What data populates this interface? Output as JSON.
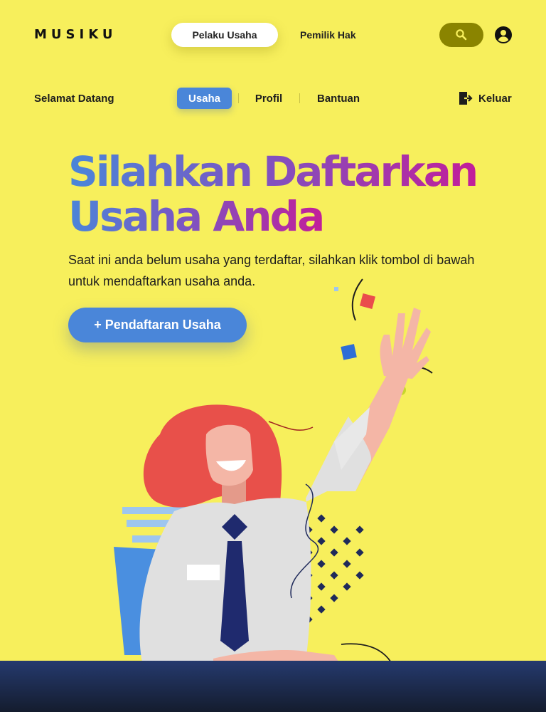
{
  "header": {
    "brand": "MUSIKU",
    "role_tabs": [
      {
        "label": "Pelaku Usaha",
        "active": true
      },
      {
        "label": "Pemilik Hak",
        "active": false
      }
    ],
    "search_icon": "search-icon",
    "account_icon": "account-circle-icon"
  },
  "subnav": {
    "welcome": "Selamat Datang",
    "tabs": [
      {
        "label": "Usaha",
        "active": true
      },
      {
        "label": "Profil",
        "active": false
      },
      {
        "label": "Bantuan",
        "active": false
      }
    ],
    "logout_label": "Keluar",
    "logout_icon": "logout-icon"
  },
  "hero": {
    "title_line1": "Silahkan Daftarkan",
    "title_line2": "Usaha Anda",
    "description": "Saat ini anda belum usaha yang terdaftar, silahkan klik tombol di bawah untuk mendaftarkan usaha anda.",
    "cta_label": "+ Pendaftaran Usaha"
  },
  "colors": {
    "background": "#f7ef5c",
    "accent": "#4a86d9",
    "search_button": "#8a8400",
    "title_gradient_end": "#c21e9a",
    "footer": "#1b2540"
  }
}
